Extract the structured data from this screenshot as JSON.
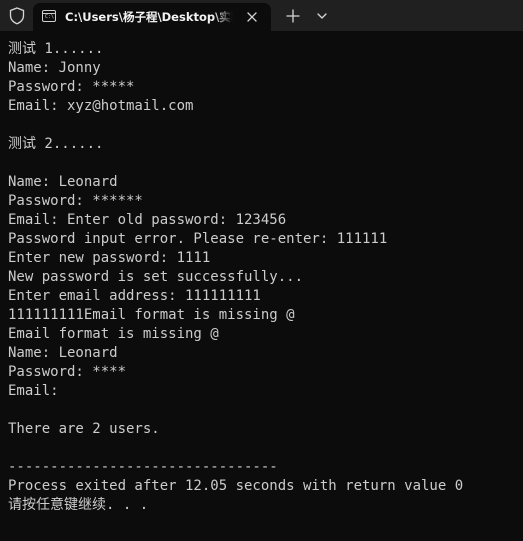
{
  "tab": {
    "title": "C:\\Users\\杨子程\\Desktop\\实验",
    "icon": "terminal-icon",
    "icon_label": "C:\\"
  },
  "titlebar": {
    "left_icon": "shield-icon",
    "close_icon": "close-icon",
    "new_tab_icon": "plus-icon",
    "dropdown_icon": "chevron-down-icon"
  },
  "console": {
    "lines": [
      "测试 1......",
      "Name: Jonny",
      "Password: *****",
      "Email: xyz@hotmail.com",
      "",
      "测试 2......",
      "",
      "Name: Leonard",
      "Password: ******",
      "Email: Enter old password: 123456",
      "Password input error. Please re-enter: 111111",
      "Enter new password: 1111",
      "New password is set successfully...",
      "Enter email address: 111111111",
      "111111111Email format is missing @",
      "Email format is missing @",
      "Name: Leonard",
      "Password: ****",
      "Email:",
      "",
      "There are 2 users.",
      "",
      "--------------------------------",
      "Process exited after 12.05 seconds with return value 0",
      "请按任意键继续. . ."
    ]
  },
  "colors": {
    "background": "#0c0c0c",
    "titlebar": "#202020",
    "text": "#cccccc"
  }
}
